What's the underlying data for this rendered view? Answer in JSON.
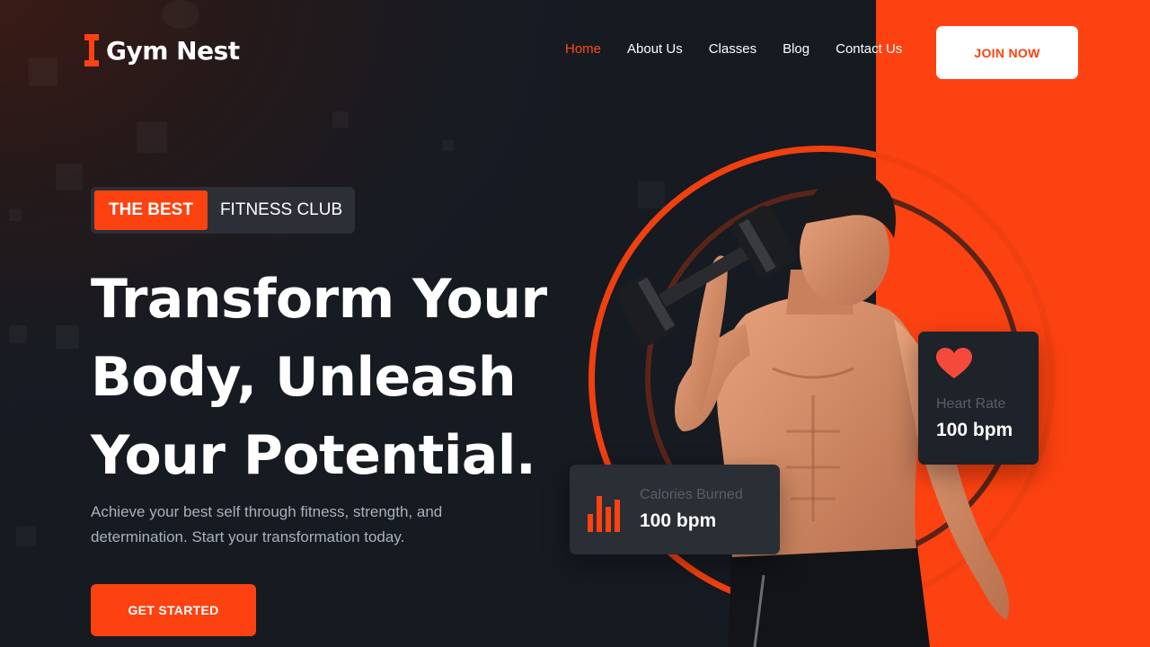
{
  "brand": {
    "name": "Gym Nest",
    "logo_icon": "dumbbell-icon",
    "accent_color": "#fd4211",
    "background_color": "#161a21"
  },
  "nav": {
    "items": [
      {
        "label": "Home",
        "active": true
      },
      {
        "label": "About Us",
        "active": false
      },
      {
        "label": "Classes",
        "active": false
      },
      {
        "label": "Blog",
        "active": false
      },
      {
        "label": "Contact Us",
        "active": false
      }
    ],
    "join_label": "JOIN NOW"
  },
  "hero": {
    "badge_highlight": "THE BEST",
    "badge_text": "FITNESS CLUB",
    "headline_lines": [
      "Transform Your",
      "Body, Unleash",
      "Your Potential."
    ],
    "subtext": "Achieve your best self through fitness, strength, and determination. Start your transformation today.",
    "cta_label": "GET STARTED"
  },
  "stats": {
    "heart": {
      "icon": "heart-icon",
      "label": "Heart Rate",
      "value": "100 bpm"
    },
    "calories": {
      "icon": "bar-chart-icon",
      "label": "Calories Burned",
      "value": "100 bpm"
    }
  },
  "media": {
    "athlete": "athlete-photo"
  }
}
